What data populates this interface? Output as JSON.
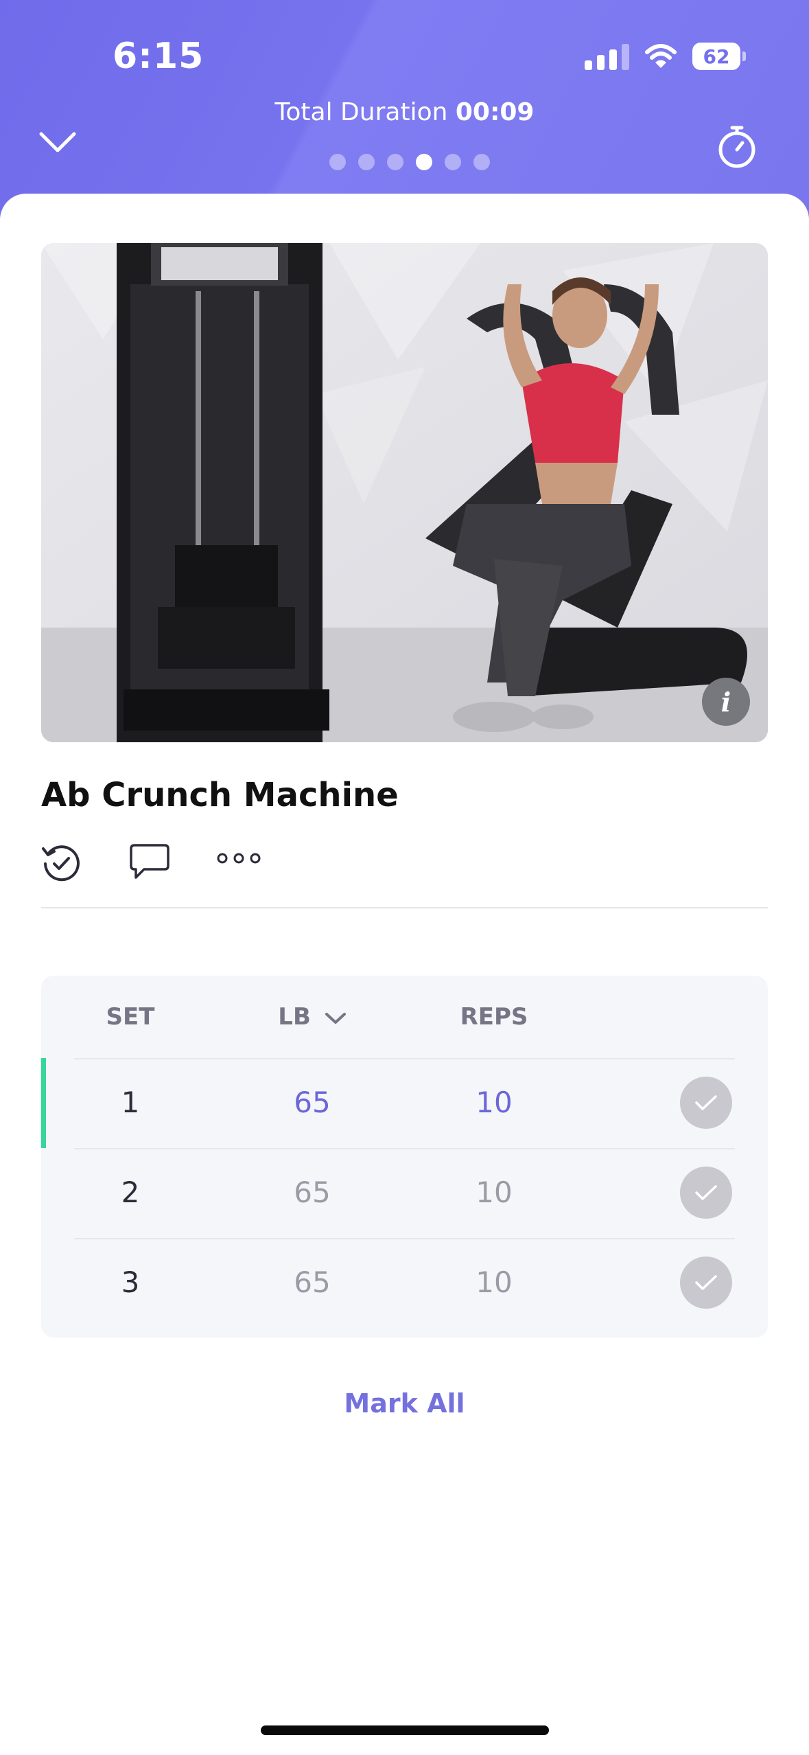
{
  "status_bar": {
    "time": "6:15",
    "battery": "62",
    "icons": [
      "cellular-signal-icon",
      "wifi-icon",
      "battery-icon"
    ]
  },
  "header": {
    "duration_label": "Total Duration",
    "duration_value": "00:09",
    "page_dots": {
      "count": 6,
      "active_index": 4
    },
    "left_icon": "chevron-down-icon",
    "right_icon": "stopwatch-icon"
  },
  "exercise": {
    "name": "Ab Crunch Machine",
    "media_info_glyph": "i",
    "actions": [
      "history-check-icon",
      "comment-icon",
      "more-icon"
    ]
  },
  "sets_table": {
    "columns": {
      "set": "SET",
      "lb": "LB",
      "reps": "REPS"
    },
    "rows": [
      {
        "set": "1",
        "lb": "65",
        "reps": "10",
        "active": true,
        "completed": false
      },
      {
        "set": "2",
        "lb": "65",
        "reps": "10",
        "active": false,
        "completed": false
      },
      {
        "set": "3",
        "lb": "65",
        "reps": "10",
        "active": false,
        "completed": false
      }
    ]
  },
  "mark_all_label": "Mark All",
  "colors": {
    "header": "#7470ec",
    "accent_text": "#6b67d8",
    "active_row_bar": "#35d69a",
    "check_button": "#c8c8ce",
    "table_bg": "#f5f6fa"
  }
}
